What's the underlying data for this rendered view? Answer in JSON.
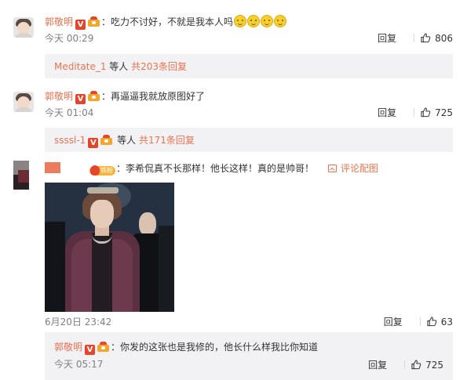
{
  "colors": {
    "username": "#eb7350",
    "accent": "#eb7350",
    "text": "#333333",
    "meta": "#808080",
    "subbox_bg": "#f2f2f5"
  },
  "icons": [
    "v-badge-icon",
    "crown-icon",
    "fan-badge-icon",
    "smile-emoji-icon",
    "like-icon",
    "picture-icon"
  ],
  "comments": [
    {
      "username": "郭敬明",
      "text": "：吃力不讨好，不就是我本人吗",
      "emoji_count": 4,
      "time": "今天 00:29",
      "reply_label": "回复",
      "likes": "806",
      "sub": {
        "user": "Meditate_1",
        "middle": " 等人 ",
        "total": "共203条回复"
      }
    },
    {
      "username": "郭敬明",
      "text": "：再逼逼我就放原图好了",
      "time": "今天 01:04",
      "reply_label": "回复",
      "likes": "725",
      "sub": {
        "user": "ssssl-1",
        "middle": " 等人 ",
        "total": "共171条回复"
      }
    },
    {
      "fan_badge": "铁粉",
      "text": "：李希侃真不长那样！他长这样！真的是帅哥！",
      "view_pic": "评论配图",
      "time": "6月20日 23:42",
      "reply_label": "回复",
      "likes": "63",
      "reply": {
        "username": "郭敬明",
        "text": "：你发的这张也是我修的，他长什么样我比你知道",
        "time": "今天 05:17",
        "reply_label": "回复",
        "likes": "725"
      }
    }
  ]
}
